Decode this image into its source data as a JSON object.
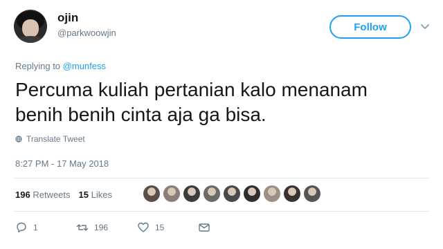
{
  "user": {
    "display_name": "ojin",
    "handle": "@parkwoowjin"
  },
  "follow_button": {
    "label": "Follow"
  },
  "reply": {
    "prefix": "Replying to",
    "mention": "@munfess"
  },
  "tweet": {
    "text": "Percuma kuliah pertanian kalo menanam benih benih cinta aja ga bisa.",
    "translate_label": "Translate Tweet",
    "timestamp": "8:27 PM - 17 May 2018"
  },
  "stats": {
    "retweets_count": "196",
    "retweets_label": "Retweets",
    "likes_count": "15",
    "likes_label": "Likes"
  },
  "liker_avatars": [
    "#5a4f48",
    "#8a7f78",
    "#3c3c3c",
    "#6b6b6b",
    "#4a4a4a",
    "#2f2f2f",
    "#9b8f88",
    "#3a3230",
    "#555555"
  ],
  "actions": {
    "reply_count": "1",
    "retweet_count": "196",
    "like_count": "15"
  },
  "colors": {
    "accent": "#1da1f2",
    "secondary_text": "#657786",
    "primary_text": "#14171a",
    "border": "#e1e8ed"
  },
  "icons": [
    "chevron-down-icon",
    "globe-icon",
    "reply-icon",
    "retweet-icon",
    "heart-icon",
    "message-icon"
  ]
}
